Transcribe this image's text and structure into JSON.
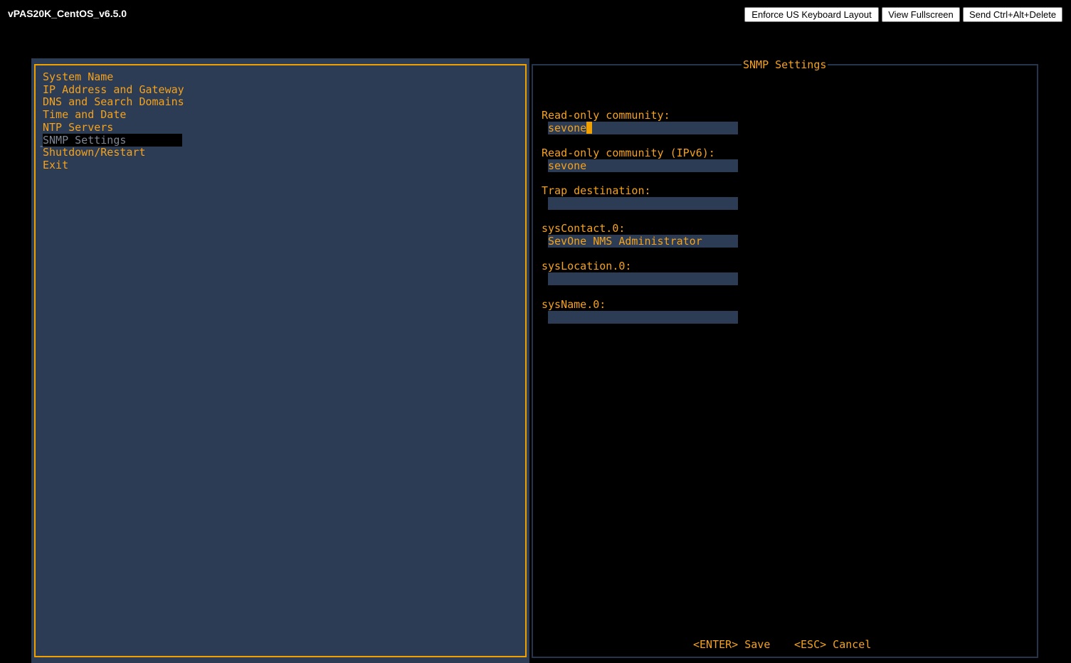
{
  "window": {
    "title": "vPAS20K_CentOS_v6.5.0"
  },
  "toolbar": {
    "enforce_keyboard_label": "Enforce US Keyboard Layout",
    "fullscreen_label": "View Fullscreen",
    "ctrl_alt_del_label": "Send Ctrl+Alt+Delete"
  },
  "menu": {
    "items": [
      {
        "label": "System Name"
      },
      {
        "label": "IP Address and Gateway"
      },
      {
        "label": "DNS and Search Domains"
      },
      {
        "label": "Time and Date"
      },
      {
        "label": "NTP Servers"
      },
      {
        "label": "SNMP Settings"
      },
      {
        "label": "Shutdown/Restart"
      },
      {
        "label": "Exit"
      }
    ],
    "selected_index": 5,
    "selection_marker": "-"
  },
  "snmp": {
    "title": "SNMP Settings",
    "fields": [
      {
        "label": "Read-only community:",
        "value": "sevone"
      },
      {
        "label": "Read-only community (IPv6):",
        "value": "sevone"
      },
      {
        "label": "Trap destination:",
        "value": ""
      },
      {
        "label": "sysContact.0:",
        "value": "SevOne NMS Administrator"
      },
      {
        "label": "sysLocation.0:",
        "value": ""
      },
      {
        "label": "sysName.0:",
        "value": ""
      }
    ],
    "save_label": "<ENTER> Save",
    "cancel_label": "<ESC> Cancel"
  },
  "colors": {
    "text_orange": "#f5a21c",
    "frame_orange": "#f0a000",
    "panel_blue": "#2c3c54",
    "selected_text_gray": "#7d8694",
    "background": "#000000"
  }
}
